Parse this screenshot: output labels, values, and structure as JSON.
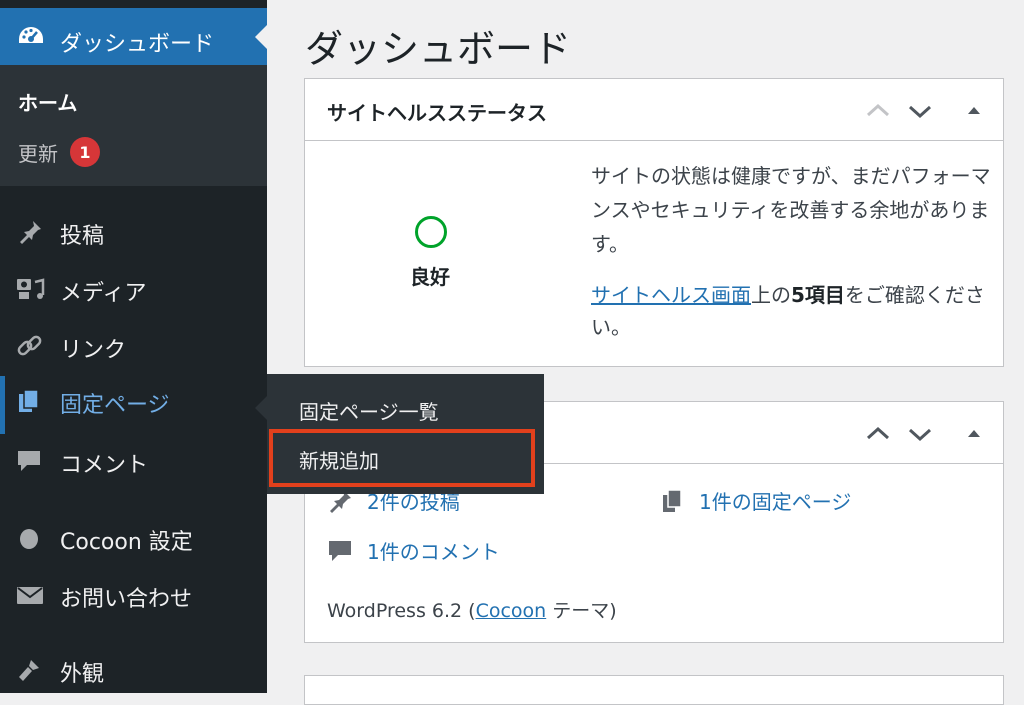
{
  "sidebar": {
    "dashboard": "ダッシュボード",
    "home": "ホーム",
    "updates": "更新",
    "updates_count": "1",
    "posts": "投稿",
    "media": "メディア",
    "links": "リンク",
    "pages": "固定ページ",
    "comments": "コメント",
    "cocoon": "Cocoon 設定",
    "contact": "お問い合わせ",
    "appearance": "外観"
  },
  "flyout": {
    "all_pages": "固定ページ一覧",
    "add_new": "新規追加"
  },
  "main": {
    "title": "ダッシュボード",
    "site_health": {
      "title": "サイトヘルスステータス",
      "status": "良好",
      "desc": "サイトの状態は健康ですが、まだパフォーマンスやセキュリティを改善する余地があります。",
      "more_link": "サイトヘルス画面",
      "more_mid": "上の",
      "more_count": "5項目",
      "more_tail": "をご確認ください。"
    },
    "glance": {
      "posts": "2件の投稿",
      "pages": "1件の固定ページ",
      "comments": "1件のコメント",
      "wp_prefix": "WordPress 6.2 (",
      "theme_link": "Cocoon",
      "wp_suffix": " テーマ)"
    }
  },
  "colors": {
    "sidebar_bg": "#1d2327",
    "accent": "#2271b1",
    "highlight_border": "#e2401c",
    "good": "#00a32a"
  }
}
